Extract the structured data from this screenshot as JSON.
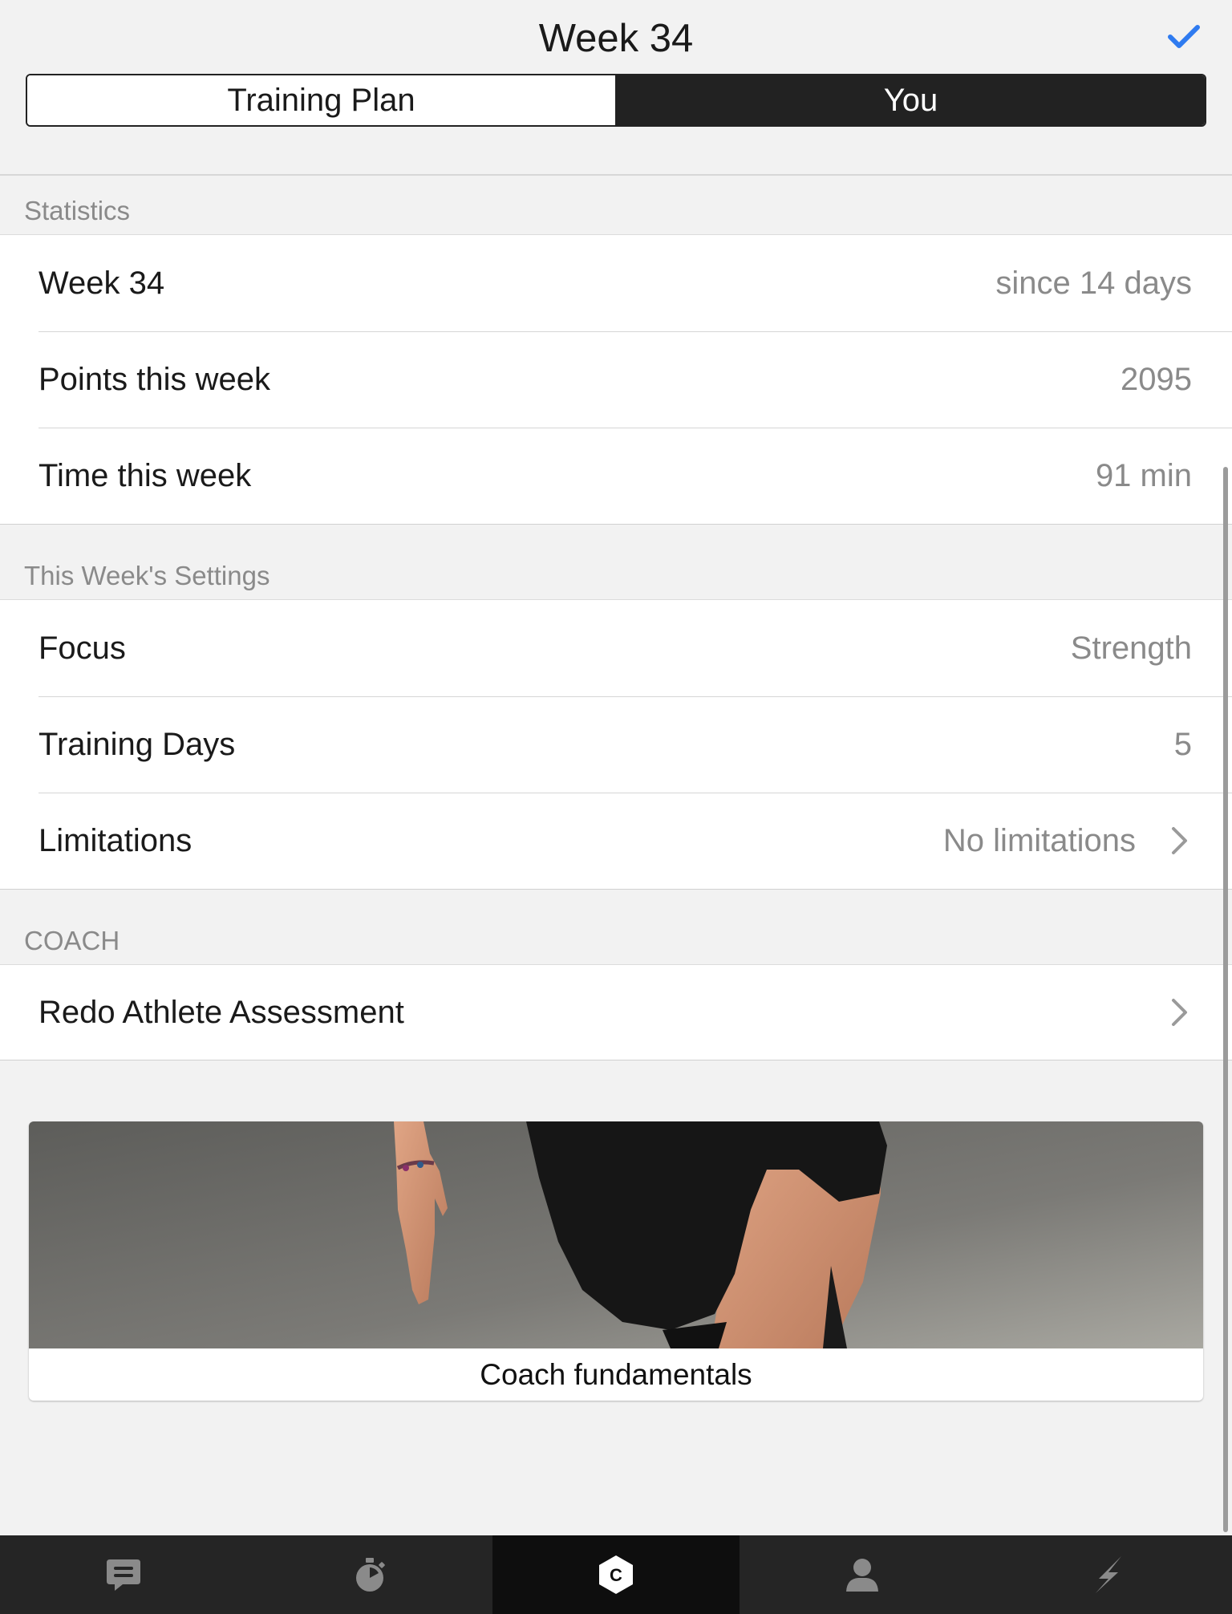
{
  "header": {
    "title": "Week 34",
    "done_icon": "checkmark-icon",
    "accent_color": "#2f7bf0"
  },
  "segmented_control": {
    "segments": [
      {
        "label": "Training Plan",
        "selected": false
      },
      {
        "label": "You",
        "selected": true
      }
    ]
  },
  "sections": {
    "statistics": {
      "title": "Statistics",
      "rows": [
        {
          "label": "Week 34",
          "value": "since 14 days"
        },
        {
          "label": "Points this week",
          "value": "2095"
        },
        {
          "label": "Time this week",
          "value": "91 min"
        }
      ]
    },
    "settings": {
      "title": "This Week's Settings",
      "rows": [
        {
          "label": "Focus",
          "value": "Strength"
        },
        {
          "label": "Training Days",
          "value": "5"
        },
        {
          "label": "Limitations",
          "value": "No limitations",
          "icon": "chevron-right-icon"
        }
      ]
    },
    "coach": {
      "title": "COACH",
      "rows": [
        {
          "label": "Redo Athlete Assessment",
          "icon": "chevron-right-icon"
        }
      ]
    }
  },
  "card": {
    "caption": "Coach fundamentals",
    "image": "athlete-knee-raise-photo"
  },
  "tab_bar": {
    "tabs": [
      {
        "icon": "chat-bubble-icon",
        "active": false
      },
      {
        "icon": "stopwatch-icon",
        "active": false
      },
      {
        "icon": "coach-hexagon-icon",
        "active": true,
        "glyph": "C"
      },
      {
        "icon": "profile-icon",
        "active": false
      },
      {
        "icon": "lightning-icon",
        "active": false
      }
    ]
  }
}
